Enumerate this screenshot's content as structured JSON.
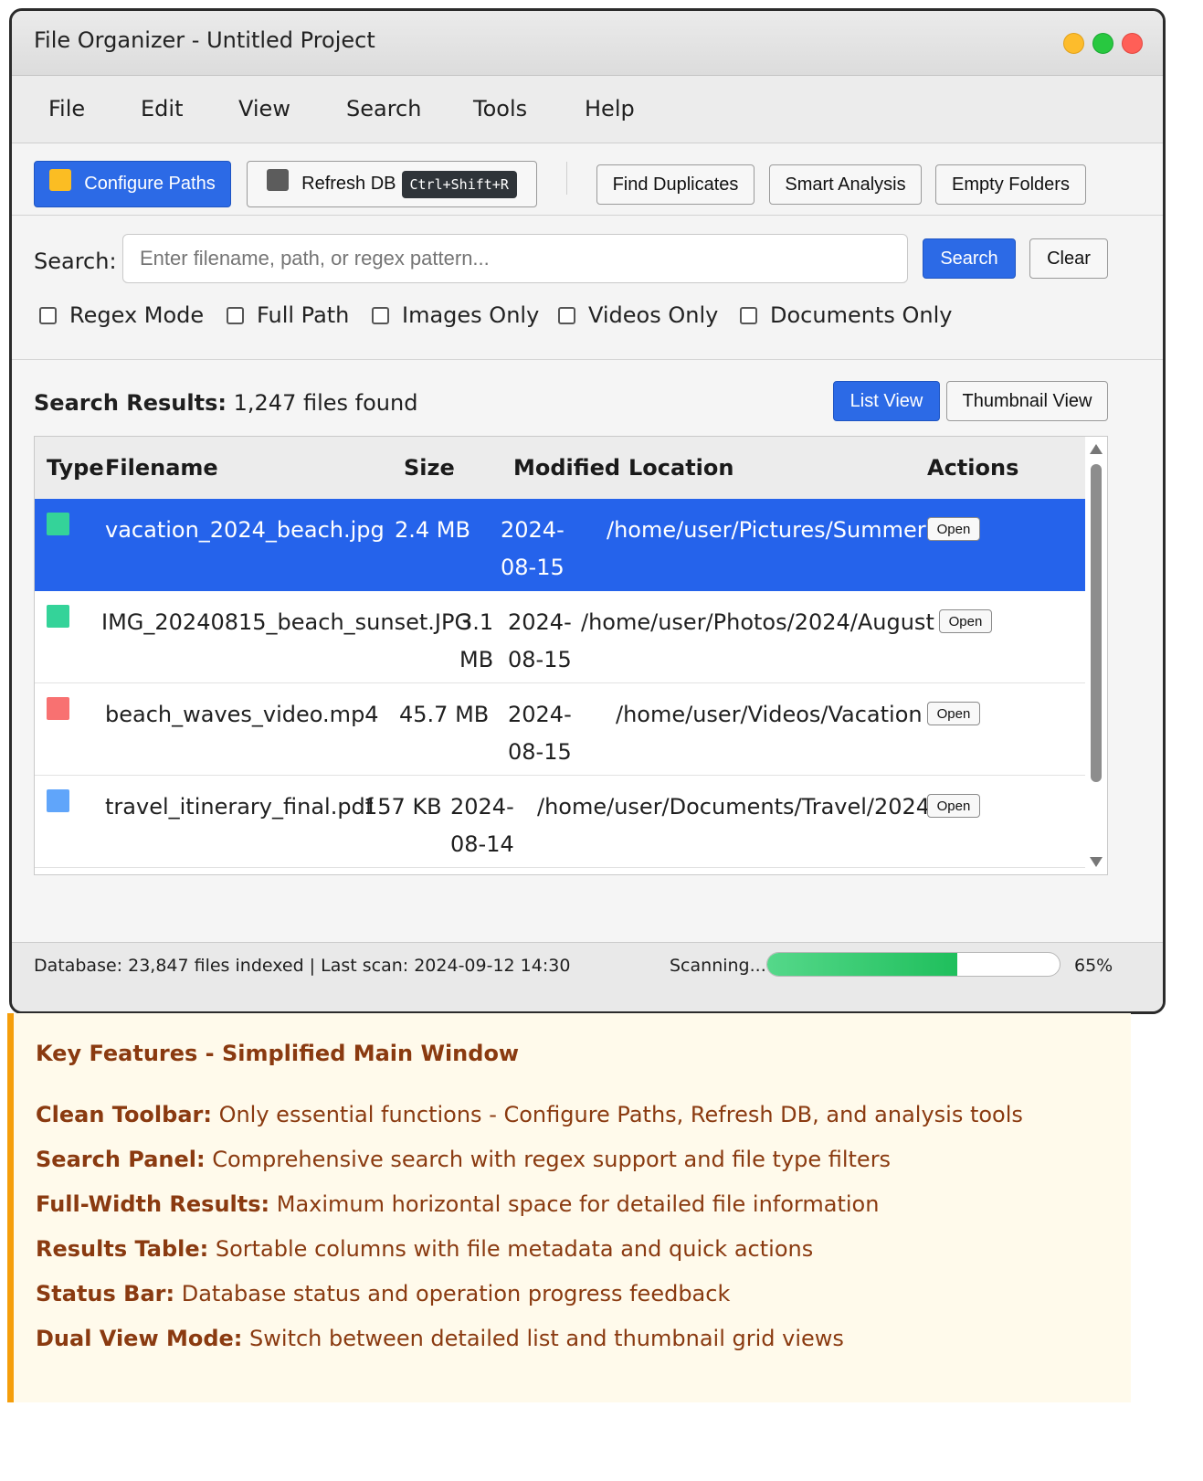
{
  "window": {
    "title": "File Organizer - Untitled Project"
  },
  "menu": [
    "File",
    "Edit",
    "View",
    "Search",
    "Tools",
    "Help"
  ],
  "toolbar": {
    "configure_label": "Configure Paths",
    "refresh_label": "Refresh DB",
    "refresh_shortcut": "Ctrl+Shift+R",
    "find_duplicates_label": "Find Duplicates",
    "smart_analysis_label": "Smart Analysis",
    "empty_folders_label": "Empty Folders"
  },
  "search": {
    "label": "Search:",
    "placeholder": "Enter filename, path, or regex pattern...",
    "search_button": "Search",
    "clear_button": "Clear",
    "filters": [
      {
        "label": "Regex Mode",
        "checked": false
      },
      {
        "label": "Full Path",
        "checked": false
      },
      {
        "label": "Images Only",
        "checked": false
      },
      {
        "label": "Videos Only",
        "checked": false
      },
      {
        "label": "Documents Only",
        "checked": false
      }
    ]
  },
  "results": {
    "title": "Search Results:",
    "count_text": "1,247 files found",
    "list_view_label": "List View",
    "thumbnail_view_label": "Thumbnail View",
    "columns": {
      "type": "Type",
      "filename": "Filename",
      "size": "Size",
      "modified": "Modified",
      "location": "Location",
      "actions": "Actions"
    },
    "rows": [
      {
        "type_color": "#34d399",
        "filename": "vacation_2024_beach.jpg",
        "size": "2.4 MB",
        "modified_line1": "2024-",
        "modified_line2": "08-15",
        "location": "/home/user/Pictures/Summer",
        "action": "Open",
        "selected": true
      },
      {
        "type_color": "#34d399",
        "filename": "IMG_20240815_beach_sunset.JPG",
        "size_line1": "3.1",
        "size_line2": "MB",
        "modified_line1": "2024-",
        "modified_line2": "08-15",
        "location": "/home/user/Photos/2024/August",
        "action": "Open",
        "selected": false
      },
      {
        "type_color": "#f87171",
        "filename": "beach_waves_video.mp4",
        "size": "45.7 MB",
        "modified_line1": "2024-",
        "modified_line2": "08-15",
        "location": "/home/user/Videos/Vacation",
        "action": "Open",
        "selected": false
      },
      {
        "type_color": "#60a5fa",
        "filename": "travel_itinerary_final.pdf",
        "size": "157 KB",
        "modified_line1": "2024-",
        "modified_line2": "08-14",
        "location": "/home/user/Documents/Travel/2024",
        "action": "Open",
        "selected": false
      }
    ]
  },
  "status": {
    "left_text": "Database: 23,847 files indexed | Last scan: 2024-09-12 14:30",
    "scan_label": "Scanning...",
    "progress_fraction": 0.65,
    "progress_text": "65%"
  },
  "features": {
    "heading": "Key Features - Simplified Main Window",
    "items": [
      {
        "key": "Clean Toolbar:",
        "text": " Only essential functions - Configure Paths, Refresh DB, and analysis tools"
      },
      {
        "key": "Search Panel:",
        "text": " Comprehensive search with regex support and file type filters"
      },
      {
        "key": "Full-Width Results:",
        "text": " Maximum horizontal space for detailed file information"
      },
      {
        "key": "Results Table:",
        "text": " Sortable columns with file metadata and quick actions"
      },
      {
        "key": "Status Bar:",
        "text": " Database status and operation progress feedback"
      },
      {
        "key": "Dual View Mode:",
        "text": " Switch between detailed list and thumbnail grid views"
      }
    ]
  },
  "colors": {
    "accent_blue": "#2c6ae6",
    "selected_row": "#2563eb",
    "image_type": "#34d399",
    "video_type": "#f87171",
    "document_type": "#60a5fa",
    "configure_icon": "#fbbd23",
    "refresh_icon": "#5c5c5c",
    "progress_green": "#1fbf5c",
    "feature_text": "#8a3a10",
    "feature_border": "#f59e0b"
  }
}
